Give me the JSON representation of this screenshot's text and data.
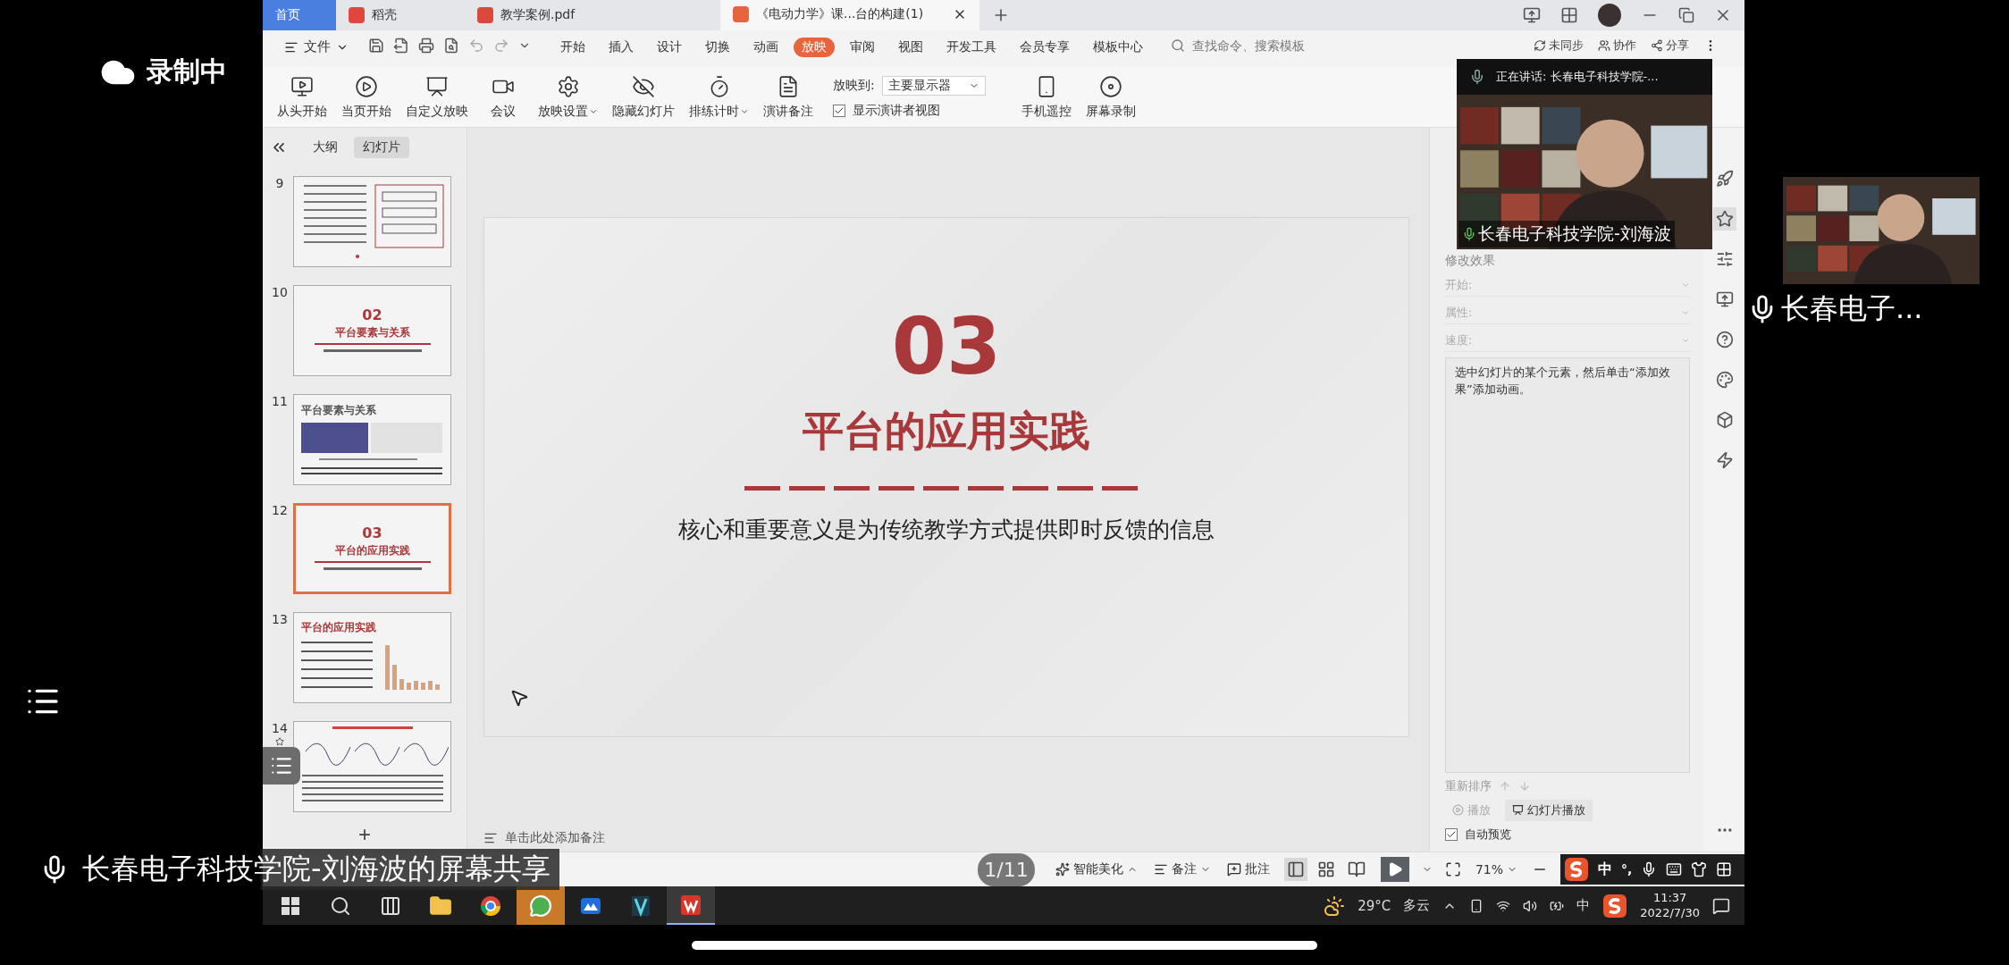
{
  "recording": {
    "label": "录制中"
  },
  "tabs": [
    {
      "label": "首页",
      "selected": false,
      "kind": "home"
    },
    {
      "label": "稻壳",
      "selected": false,
      "kind": "docer"
    },
    {
      "label": "教学案例.pdf",
      "selected": false,
      "kind": "pdf"
    },
    {
      "label": "《电动力学》课...台的构建(1)",
      "selected": true,
      "kind": "ppt"
    }
  ],
  "file_menu": "文件",
  "menu": [
    {
      "label": "开始",
      "selected": false
    },
    {
      "label": "插入",
      "selected": false
    },
    {
      "label": "设计",
      "selected": false
    },
    {
      "label": "切换",
      "selected": false
    },
    {
      "label": "动画",
      "selected": false
    },
    {
      "label": "放映",
      "selected": true
    },
    {
      "label": "审阅",
      "selected": false
    },
    {
      "label": "视图",
      "selected": false
    },
    {
      "label": "开发工具",
      "selected": false
    },
    {
      "label": "会员专享",
      "selected": false
    },
    {
      "label": "模板中心",
      "selected": false
    }
  ],
  "search": {
    "placeholder": "查找命令、搜索模板"
  },
  "account_actions": [
    "未同步",
    "协作",
    "分享"
  ],
  "ribbon": [
    {
      "label": "从头开始",
      "has_menu": false
    },
    {
      "label": "当页开始",
      "has_menu": false
    },
    {
      "label": "自定义放映",
      "has_menu": false
    },
    {
      "label": "会议",
      "has_menu": false
    },
    {
      "label": "放映设置",
      "has_menu": true
    },
    {
      "label": "隐藏幻灯片",
      "has_menu": false
    },
    {
      "label": "排练计时",
      "has_menu": true
    },
    {
      "label": "演讲备注",
      "has_menu": false
    }
  ],
  "display_to": {
    "label": "放映到:",
    "value": "主要显示器"
  },
  "presenter_view": {
    "label": "显示演讲者视图",
    "checked": true
  },
  "ribbon_extra": [
    {
      "label": "手机遥控"
    },
    {
      "label": "屏幕录制"
    }
  ],
  "slide_panel": {
    "tabs": [
      {
        "label": "大纲",
        "selected": false
      },
      {
        "label": "幻灯片",
        "selected": true
      }
    ],
    "slides": [
      {
        "number": "9",
        "selected": false,
        "kind": "diagram",
        "animated": false
      },
      {
        "number": "10",
        "selected": false,
        "kind": "section",
        "heading": "02",
        "title": "平台要素与关系",
        "animated": false
      },
      {
        "number": "11",
        "selected": false,
        "kind": "screenshot",
        "title": "平台要素与关系",
        "animated": false
      },
      {
        "number": "12",
        "selected": true,
        "kind": "section",
        "heading": "03",
        "title": "平台的应用实践",
        "animated": false
      },
      {
        "number": "13",
        "selected": false,
        "kind": "chart",
        "title": "平台的应用实践",
        "animated": false
      },
      {
        "number": "14",
        "selected": false,
        "kind": "curves",
        "animated": true
      }
    ],
    "add_button": "+"
  },
  "slide": {
    "heading": "03",
    "title": "平台的应用实践",
    "subtitle": "核心和重要意义是为传统教学方式提供即时反馈的信息"
  },
  "notes": {
    "placeholder": "单击此处添加备注"
  },
  "animation_panel": {
    "section": "修改效果",
    "fields": [
      {
        "label": "开始:"
      },
      {
        "label": "属性:"
      },
      {
        "label": "速度:"
      }
    ],
    "hint": "选中幻灯片的某个元素，然后单击“添加效果”添加动画。",
    "reorder": "重新排序",
    "play": {
      "label": "播放",
      "disabled": true
    },
    "slideshow": {
      "label": "幻灯片播放"
    },
    "autopreview": {
      "label": "自动预览",
      "checked": true
    }
  },
  "speaker": {
    "status": "正在讲话: 长春电子科技学院-...",
    "name": "长春电子科技学院-刘海波"
  },
  "status_bar": {
    "page": "1/11",
    "beautify": "智能美化",
    "notes": "备注",
    "comments": "批注",
    "views": [
      {
        "selected": true
      },
      {
        "selected": false
      },
      {
        "selected": false
      }
    ],
    "zoom": "71%"
  },
  "ime": {
    "mode": "中",
    "punct": "°,"
  },
  "taskbar": {
    "apps": [
      {
        "kind": "start",
        "selected": false
      },
      {
        "kind": "search",
        "selected": false
      },
      {
        "kind": "taskview",
        "selected": false
      },
      {
        "kind": "explorer",
        "selected": false
      },
      {
        "kind": "chrome",
        "selected": false
      },
      {
        "kind": "wechat",
        "selected": true
      },
      {
        "kind": "lanxin",
        "selected": false
      },
      {
        "kind": "vapp",
        "selected": false
      },
      {
        "kind": "wps",
        "selected": true
      }
    ],
    "weather": {
      "temp": "29°C",
      "text": "多云"
    },
    "ime": "中",
    "time": "11:37",
    "date": "2022/7/30"
  },
  "share_label": "长春电子科技学院-刘海波的屏幕共享",
  "participant": {
    "name": "长春电子..."
  }
}
